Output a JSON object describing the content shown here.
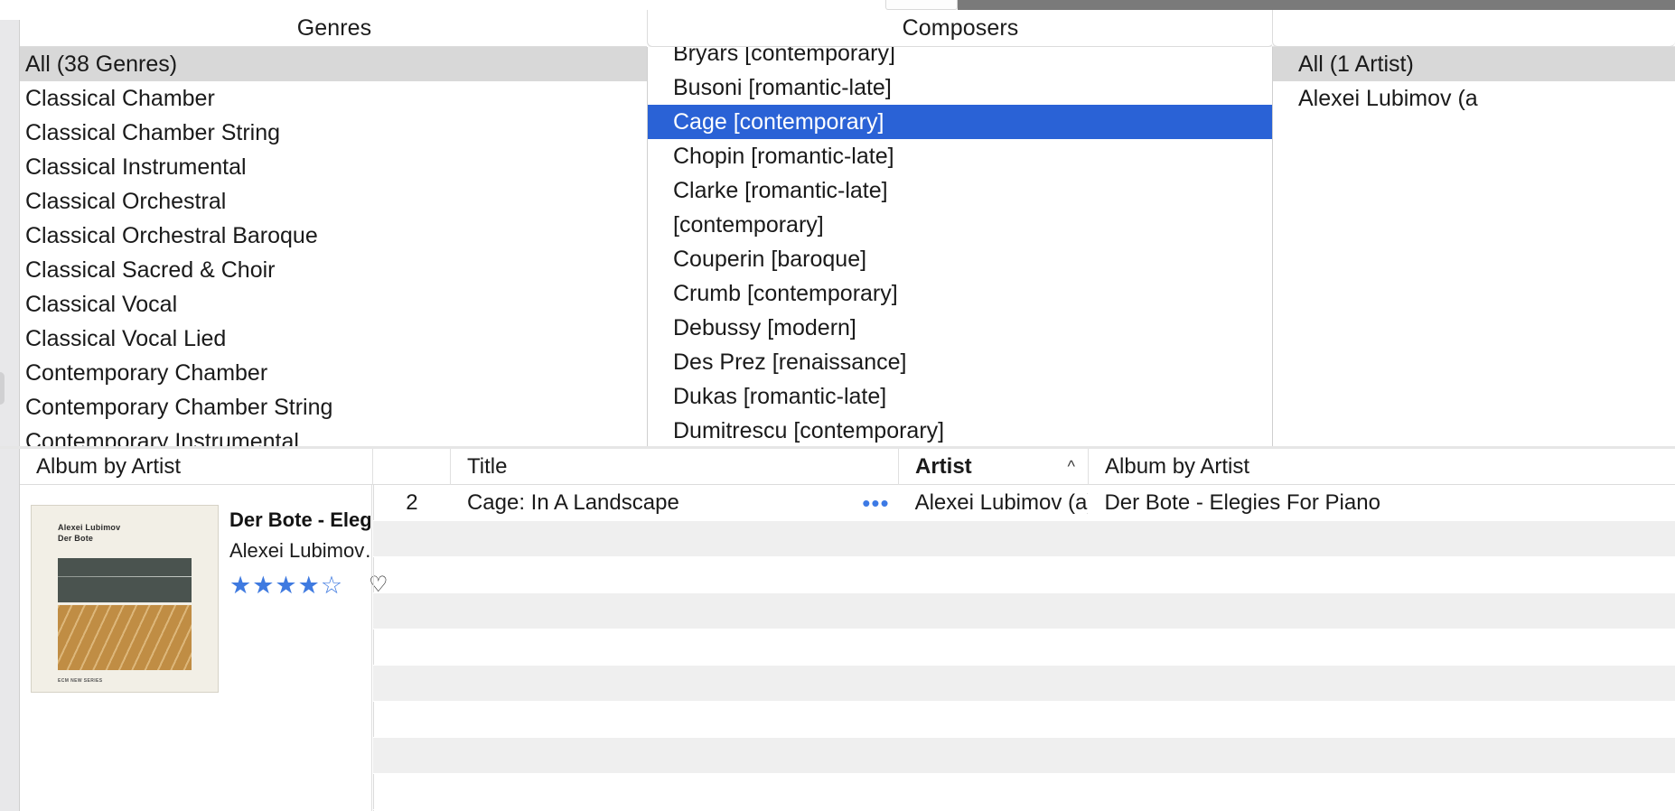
{
  "window": {
    "app": "Music Library Browser"
  },
  "browser": {
    "genres": {
      "header": "Genres",
      "all_row": "All (38 Genres)",
      "items": [
        "Classical Chamber",
        "Classical Chamber String",
        "Classical Instrumental",
        "Classical Orchestral",
        "Classical Orchestral Baroque",
        "Classical Sacred & Choir",
        "Classical Vocal",
        "Classical Vocal Lied",
        "Contemporary Chamber",
        "Contemporary Chamber String",
        "Contemporary Instrumental"
      ],
      "selected": "All (38 Genres)"
    },
    "composers": {
      "header": "Composers",
      "clipped_top": "Bryars [contemporary]",
      "items": [
        "Busoni [romantic-late]",
        "Cage [contemporary]",
        "Chopin [romantic-late]",
        "Clarke [romantic-late]",
        "[contemporary]",
        "Couperin [baroque]",
        "Crumb [contemporary]",
        "Debussy [modern]",
        "Des Prez [renaissance]",
        "Dukas [romantic-late]",
        "Dumitrescu [contemporary]"
      ],
      "selected": "Cage [contemporary]",
      "selection_color": "#2a62d6"
    },
    "artists": {
      "header": "",
      "all_row": "All (1 Artist)",
      "items": [
        "Alexei Lubimov (a"
      ],
      "selected": "All (1 Artist)"
    }
  },
  "track_table": {
    "columns": [
      {
        "label": "Album by Artist",
        "sorted": false,
        "sort_caret": ""
      },
      {
        "label": "",
        "sorted": false,
        "sort_caret": ""
      },
      {
        "label": "Title",
        "sorted": false,
        "sort_caret": ""
      },
      {
        "label": "Artist",
        "sorted": true,
        "sort_caret": "^"
      },
      {
        "label": "Album by Artist",
        "sorted": false,
        "sort_caret": ""
      }
    ],
    "rows": [
      {
        "number": "2",
        "title": "Cage: In A Landscape",
        "overflow_icon": "•••",
        "artist": "Alexei Lubimov (a)",
        "album_by_artist": "Der Bote - Elegies For Piano"
      }
    ],
    "empty_row_count": 8
  },
  "album_panel": {
    "album_title": "Der Bote - Eleg…",
    "album_artist": "Alexei Lubimov…",
    "rating_filled": 4,
    "rating_total": 5,
    "star_filled_glyph": "★",
    "star_empty_glyph": "☆",
    "heart_glyph": "♡",
    "accent_color": "#3f7ae0",
    "artwork": {
      "line1": "Alexei Lubimov",
      "line2": "Der Bote",
      "footer": "ECM NEW SERIES"
    }
  }
}
